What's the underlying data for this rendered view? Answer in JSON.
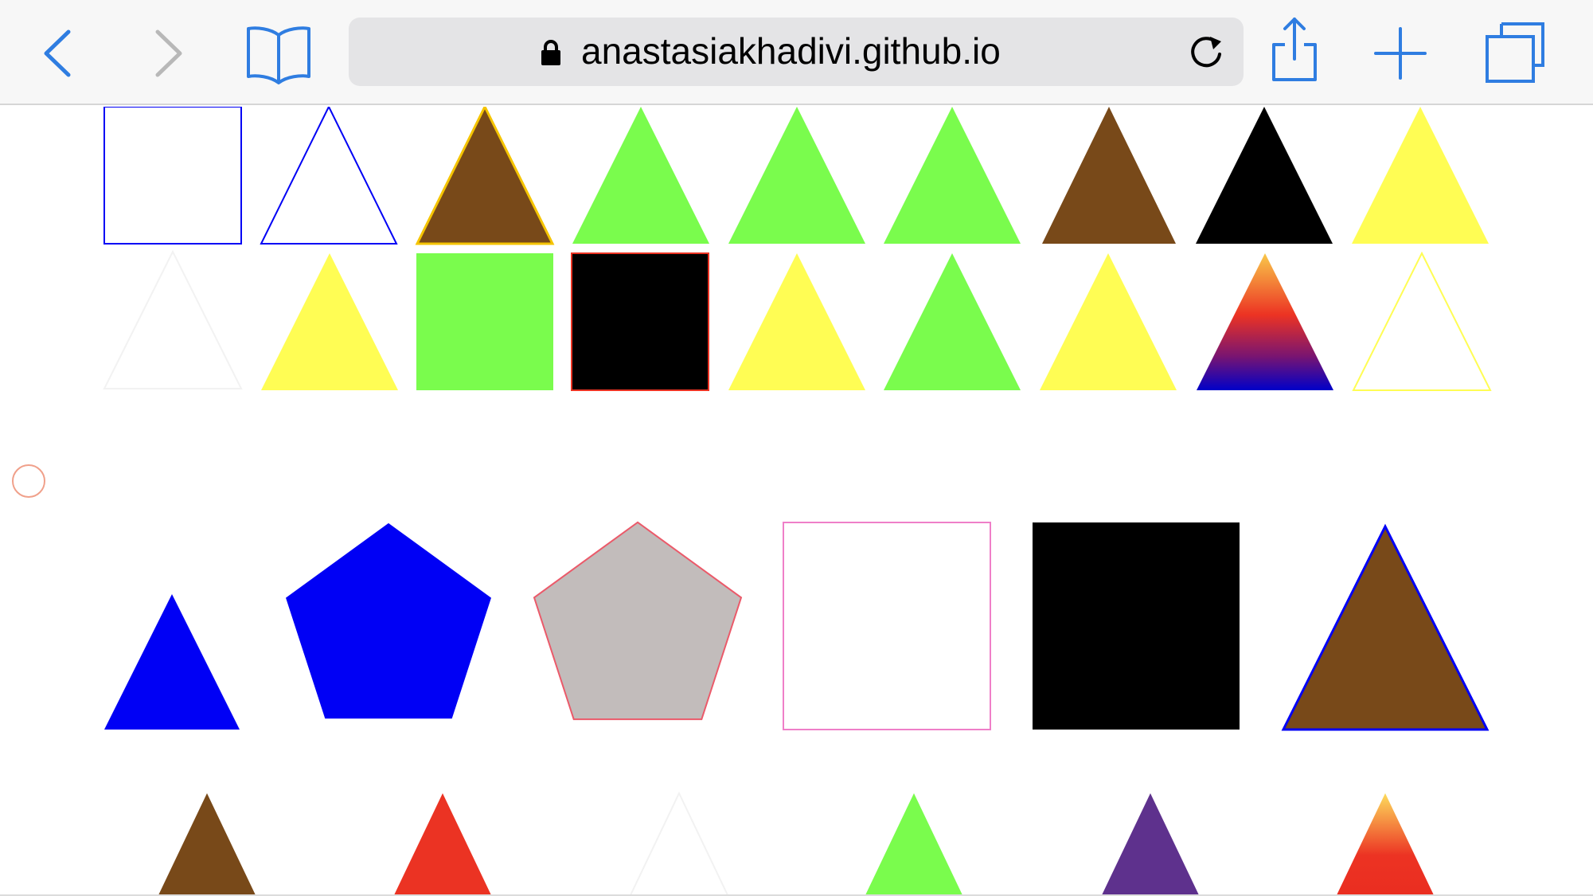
{
  "browser": {
    "url": "anastasiakhadivi.github.io",
    "accent_color": "#2f7de1",
    "disabled_color": "#b8b8b8",
    "icons": {
      "back": "chevron-left-icon",
      "forward": "chevron-right-icon",
      "bookmarks": "open-book-icon",
      "lock": "lock-icon",
      "reload": "reload-icon",
      "share": "share-icon",
      "new_tab": "plus-icon",
      "tabs": "tabs-icon"
    }
  },
  "shapes": [
    {
      "shape": "square",
      "fill": "#ffffff",
      "stroke": "#0000f5"
    },
    {
      "shape": "triangle",
      "fill": "#ffffff",
      "stroke": "#0000f5"
    },
    {
      "shape": "triangle",
      "fill": "#784919",
      "stroke": "#f5c400"
    },
    {
      "shape": "triangle",
      "fill": "#7afc4d",
      "stroke": "none"
    },
    {
      "shape": "triangle",
      "fill": "#7afc4d",
      "stroke": "none"
    },
    {
      "shape": "triangle",
      "fill": "#7afc4d",
      "stroke": "none"
    },
    {
      "shape": "triangle",
      "fill": "#784919",
      "stroke": "none"
    },
    {
      "shape": "triangle",
      "fill": "#000000",
      "stroke": "none"
    },
    {
      "shape": "triangle",
      "fill": "#fffd54",
      "stroke": "none"
    },
    {
      "shape": "triangle",
      "fill": "#ffffff",
      "stroke": "#f2f2f2"
    },
    {
      "shape": "triangle",
      "fill": "#fffd54",
      "stroke": "none"
    },
    {
      "shape": "square",
      "fill": "#7afc4d",
      "stroke": "none"
    },
    {
      "shape": "square",
      "fill": "#000000",
      "stroke": "#eb3323"
    },
    {
      "shape": "triangle",
      "fill": "#fffd54",
      "stroke": "none"
    },
    {
      "shape": "triangle",
      "fill": "#7afc4d",
      "stroke": "none"
    },
    {
      "shape": "triangle",
      "fill": "#fffd54",
      "stroke": "none"
    },
    {
      "shape": "triangle",
      "fill": "gradient-sunset",
      "stroke": "none"
    },
    {
      "shape": "triangle",
      "fill": "#ffffff",
      "stroke": "#fffd54"
    },
    {
      "shape": "circle",
      "fill": "#ffffff",
      "stroke": "#f0a08a"
    },
    {
      "shape": "triangle",
      "fill": "#0000f5",
      "stroke": "none"
    },
    {
      "shape": "pentagon",
      "fill": "#0000f5",
      "stroke": "none"
    },
    {
      "shape": "pentagon",
      "fill": "#c2bcbb",
      "stroke": "#eb5a6a"
    },
    {
      "shape": "square",
      "fill": "#ffffff",
      "stroke": "#ef7fc8"
    },
    {
      "shape": "square",
      "fill": "#000000",
      "stroke": "none"
    },
    {
      "shape": "triangle",
      "fill": "#784919",
      "stroke": "#0000f5"
    },
    {
      "shape": "triangle",
      "fill": "#784919",
      "stroke": "none"
    },
    {
      "shape": "triangle",
      "fill": "#eb3323",
      "stroke": "none"
    },
    {
      "shape": "triangle",
      "fill": "#ffffff",
      "stroke": "#f2f2f2"
    },
    {
      "shape": "triangle",
      "fill": "#7afc4d",
      "stroke": "none"
    },
    {
      "shape": "triangle",
      "fill": "#5e318d",
      "stroke": "none"
    },
    {
      "shape": "triangle",
      "fill": "gradient-warm",
      "stroke": "none"
    }
  ]
}
